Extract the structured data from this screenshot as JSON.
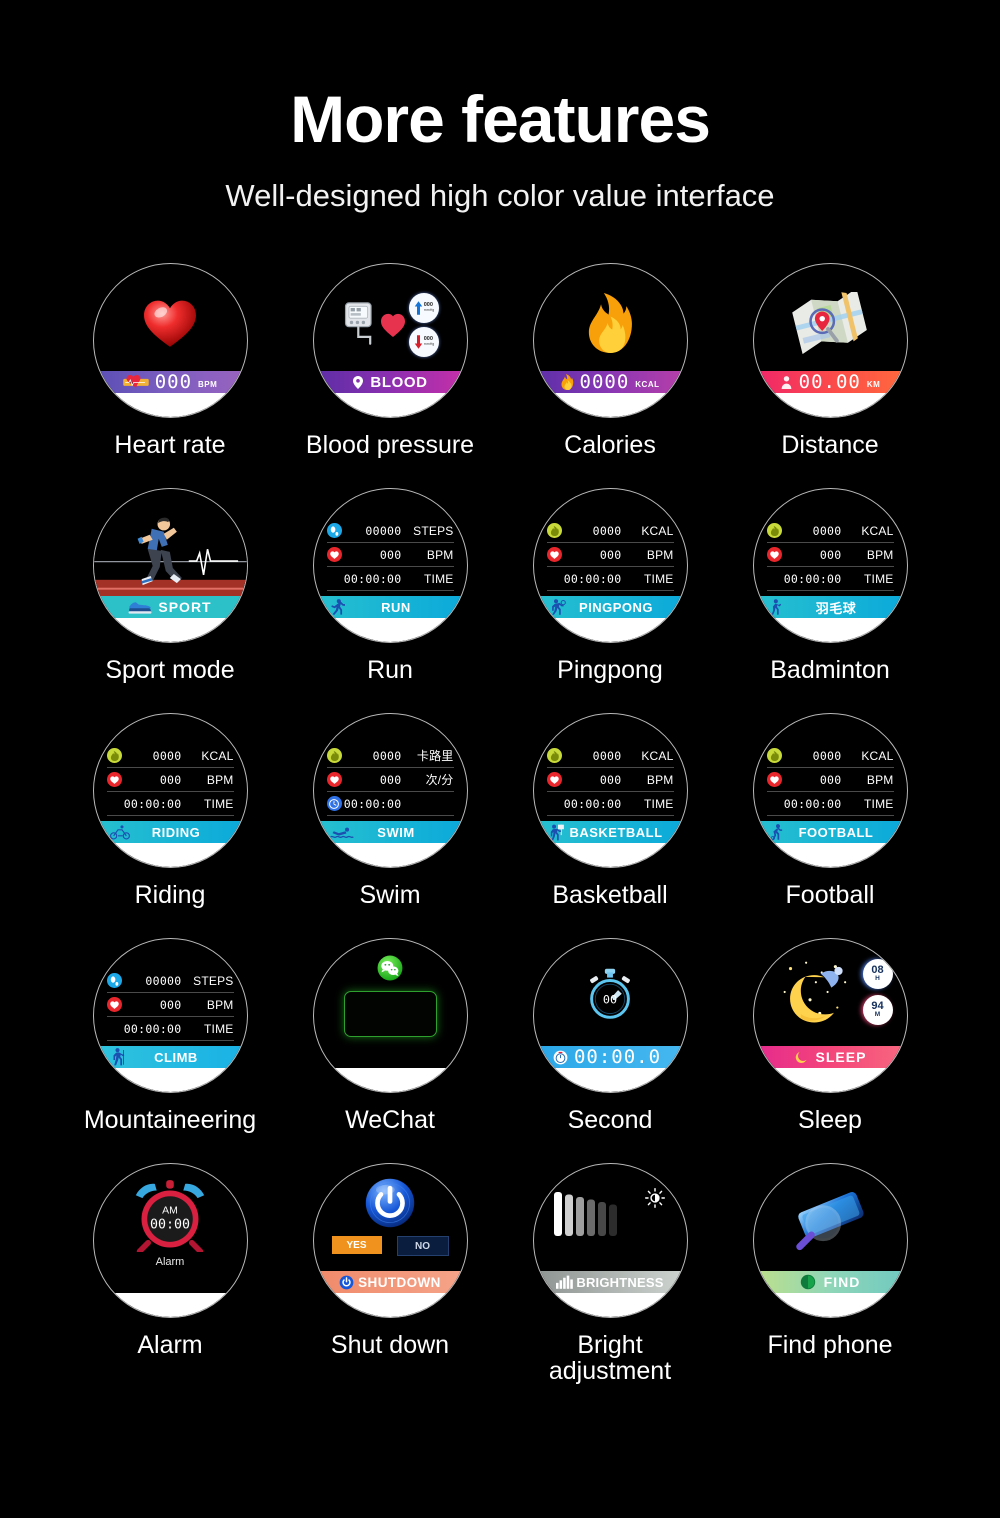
{
  "header": {
    "title": "More features",
    "subtitle": "Well-designed high color value interface"
  },
  "colors": {
    "background": "#000000",
    "text": "#ffffff",
    "dial_border": "#b9b9b9",
    "chin": "#ffffff",
    "teal_bar_start": "#27c0cf",
    "teal_bar_end": "#0aa9da",
    "kcal_icon": "#c8d93a",
    "bpm_icon": "#e8262b",
    "steps_icon": "#1da8e8",
    "clock_icon": "#2f72e8"
  },
  "tiles": [
    {
      "id": "heart-rate",
      "label": "Heart rate",
      "face": "icon-bar",
      "icon": "heart-3d-icon",
      "bar": {
        "value": "000",
        "unit": "BPM",
        "gradient": [
          "#5a4fb5",
          "#7d5ec0",
          "#9a63bf"
        ],
        "glyph": "heart-band-icon"
      }
    },
    {
      "id": "blood-pressure",
      "label": "Blood pressure",
      "face": "blood-pressure",
      "bar": {
        "value": "",
        "text": "BLOOD",
        "unit": "",
        "gradient": [
          "#5b2ea6",
          "#8c2fb0",
          "#c92fa8"
        ],
        "glyph": "location-pin-icon"
      },
      "badges": [
        {
          "dir": "up",
          "value": "000",
          "unit": "mmHg"
        },
        {
          "dir": "down",
          "value": "000",
          "unit": "mmHg"
        }
      ]
    },
    {
      "id": "calories",
      "label": "Calories",
      "face": "icon-bar",
      "icon": "flame-icon",
      "bar": {
        "value": "0000",
        "unit": "KCAL",
        "gradient": [
          "#5b2fa8",
          "#8a37b4",
          "#b93fa8"
        ],
        "glyph": "flame-small-icon"
      }
    },
    {
      "id": "distance",
      "label": "Distance",
      "face": "icon-bar",
      "icon": "map-icon",
      "bar": {
        "value": "00.00",
        "unit": "KM",
        "gradient": [
          "#f0256b",
          "#fb4a4a",
          "#ff6a3d"
        ],
        "glyph": "person-pin-icon"
      }
    },
    {
      "id": "sport-mode",
      "label": "Sport mode",
      "face": "sport-mode",
      "bar": {
        "text": "SPORT",
        "gradient": [
          "#2cc0c8",
          "#2cc0c8"
        ],
        "glyph": "shoe-icon"
      }
    },
    {
      "id": "run",
      "label": "Run",
      "face": "stats",
      "rows": [
        {
          "icon": "steps-icon",
          "value": "00000",
          "unit": "STEPS"
        },
        {
          "icon": "heart-icon",
          "value": "000",
          "unit": "BPM"
        },
        {
          "icon": "",
          "value": "00:00:00",
          "unit": "TIME"
        }
      ],
      "bar": {
        "text": "RUN",
        "gradient": [
          "#27c0cf",
          "#0aa9da"
        ],
        "glyph": "runner-icon"
      }
    },
    {
      "id": "pingpong",
      "label": "Pingpong",
      "face": "stats",
      "rows": [
        {
          "icon": "kcal-icon",
          "value": "0000",
          "unit": "KCAL"
        },
        {
          "icon": "heart-icon",
          "value": "000",
          "unit": "BPM"
        },
        {
          "icon": "",
          "value": "00:00:00",
          "unit": "TIME"
        }
      ],
      "bar": {
        "text": "PINGPONG",
        "gradient": [
          "#27c0cf",
          "#0aa9da"
        ],
        "glyph": "pingpong-icon"
      }
    },
    {
      "id": "badminton",
      "label": "Badminton",
      "face": "stats",
      "rows": [
        {
          "icon": "kcal-icon",
          "value": "0000",
          "unit": "KCAL"
        },
        {
          "icon": "heart-icon",
          "value": "000",
          "unit": "BPM"
        },
        {
          "icon": "",
          "value": "00:00:00",
          "unit": "TIME"
        }
      ],
      "bar": {
        "text": "羽毛球",
        "gradient": [
          "#27c0cf",
          "#0aa9da"
        ],
        "glyph": "badminton-icon"
      }
    },
    {
      "id": "riding",
      "label": "Riding",
      "face": "stats",
      "rows": [
        {
          "icon": "kcal-icon",
          "value": "0000",
          "unit": "KCAL"
        },
        {
          "icon": "heart-icon",
          "value": "000",
          "unit": "BPM"
        },
        {
          "icon": "",
          "value": "00:00:00",
          "unit": "TIME"
        }
      ],
      "bar": {
        "text": "RIDING",
        "gradient": [
          "#27c0cf",
          "#0aa9da"
        ],
        "glyph": "bicycle-icon"
      }
    },
    {
      "id": "swim",
      "label": "Swim",
      "face": "stats",
      "rows": [
        {
          "icon": "kcal-icon",
          "value": "0000",
          "unit": "卡路里"
        },
        {
          "icon": "heart-icon",
          "value": "000",
          "unit": "次/分"
        },
        {
          "icon": "clock-icon",
          "value": "00:00:00",
          "unit": ""
        }
      ],
      "bar": {
        "text": "SWIM",
        "gradient": [
          "#27c0cf",
          "#0aa9da"
        ],
        "glyph": "swimmer-icon"
      }
    },
    {
      "id": "basketball",
      "label": "Basketball",
      "face": "stats",
      "rows": [
        {
          "icon": "kcal-icon",
          "value": "0000",
          "unit": "KCAL"
        },
        {
          "icon": "heart-icon",
          "value": "000",
          "unit": "BPM"
        },
        {
          "icon": "",
          "value": "00:00:00",
          "unit": "TIME"
        }
      ],
      "bar": {
        "text": "BASKETBALL",
        "gradient": [
          "#27c0cf",
          "#0aa9da"
        ],
        "glyph": "basketball-icon"
      }
    },
    {
      "id": "football",
      "label": "Football",
      "face": "stats",
      "rows": [
        {
          "icon": "kcal-icon",
          "value": "0000",
          "unit": "KCAL"
        },
        {
          "icon": "heart-icon",
          "value": "000",
          "unit": "BPM"
        },
        {
          "icon": "",
          "value": "00:00:00",
          "unit": "TIME"
        }
      ],
      "bar": {
        "text": "FOOTBALL",
        "gradient": [
          "#27c0cf",
          "#0aa9da"
        ],
        "glyph": "football-icon"
      }
    },
    {
      "id": "mountaineering",
      "label": "Mountaineering",
      "face": "stats",
      "rows": [
        {
          "icon": "steps-icon",
          "value": "00000",
          "unit": "STEPS"
        },
        {
          "icon": "heart-icon",
          "value": "000",
          "unit": "BPM"
        },
        {
          "icon": "",
          "value": "00:00:00",
          "unit": "TIME"
        }
      ],
      "bar": {
        "text": "CLIMB",
        "gradient": [
          "#2fc3dd",
          "#19b1e6"
        ],
        "glyph": "hiker-icon"
      }
    },
    {
      "id": "wechat",
      "label": "WeChat",
      "face": "wechat",
      "icon": "wechat-icon"
    },
    {
      "id": "second",
      "label": "Second",
      "face": "icon-bar",
      "icon": "stopwatch-icon",
      "stopwatch_value": "00",
      "bar": {
        "value": "00:00.0",
        "unit": "",
        "gradient": [
          "#2aa7e8",
          "#46b8f0"
        ],
        "glyph": "stopwatch-small-icon"
      }
    },
    {
      "id": "sleep",
      "label": "Sleep",
      "face": "sleep",
      "icon": "moon-icon",
      "badges": [
        {
          "value": "08",
          "unit": "H"
        },
        {
          "value": "94",
          "unit": "M"
        }
      ],
      "bar": {
        "text": "SLEEP",
        "gradient": [
          "#e52a8e",
          "#f4457a",
          "#f8687f"
        ],
        "glyph": "moon-small-icon"
      }
    },
    {
      "id": "alarm",
      "label": "Alarm",
      "face": "alarm",
      "icon": "alarm-clock-icon",
      "meridiem": "AM",
      "time": "00:00",
      "caption": "Alarm"
    },
    {
      "id": "shutdown",
      "label": "Shut down",
      "face": "shutdown",
      "icon": "power-icon",
      "yes_label": "YES",
      "no_label": "NO",
      "bar": {
        "text": "SHUTDOWN",
        "gradient": [
          "#f08a6a",
          "#f5a48a"
        ],
        "glyph": "power-small-icon"
      }
    },
    {
      "id": "brightness",
      "label": "Bright\nadjustment",
      "face": "brightness",
      "icon": "sun-icon",
      "bar": {
        "text": "BRIGHTNESS",
        "gradient": [
          "#8d9390",
          "#cfd6d2"
        ],
        "glyph": "bars-icon"
      }
    },
    {
      "id": "find-phone",
      "label": "Find phone",
      "face": "find-phone",
      "icon": "phone-magnifier-icon",
      "bar": {
        "text": "FIND",
        "gradient": [
          "#bfe08a",
          "#8fd6b8",
          "#6fc9c0"
        ],
        "glyph": "green-dot-icon"
      }
    }
  ]
}
